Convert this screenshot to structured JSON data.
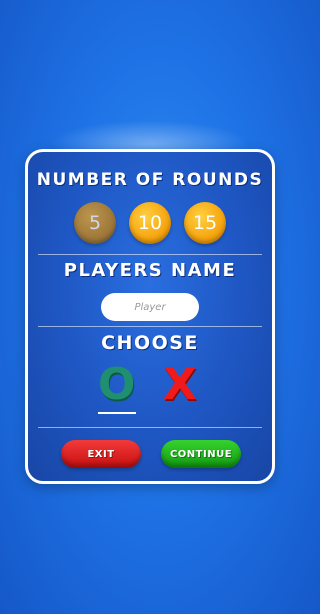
{
  "rounds": {
    "heading": "NUMBER OF ROUNDS",
    "options": [
      "5",
      "10",
      "15"
    ]
  },
  "players": {
    "heading": "PLAYERS NAME",
    "placeholder": "Player"
  },
  "choose": {
    "heading": "CHOOSE",
    "symbol_o": "O",
    "symbol_x": "X"
  },
  "buttons": {
    "exit_label": "EXIT",
    "continue_label": "CONTINUE"
  },
  "colors": {
    "background": "#1f73e6",
    "round_active": "#f6a50f",
    "symbol_o": "#1f8f70",
    "symbol_x": "#f01a1a",
    "exit": "#e02020",
    "continue": "#22b81c"
  }
}
